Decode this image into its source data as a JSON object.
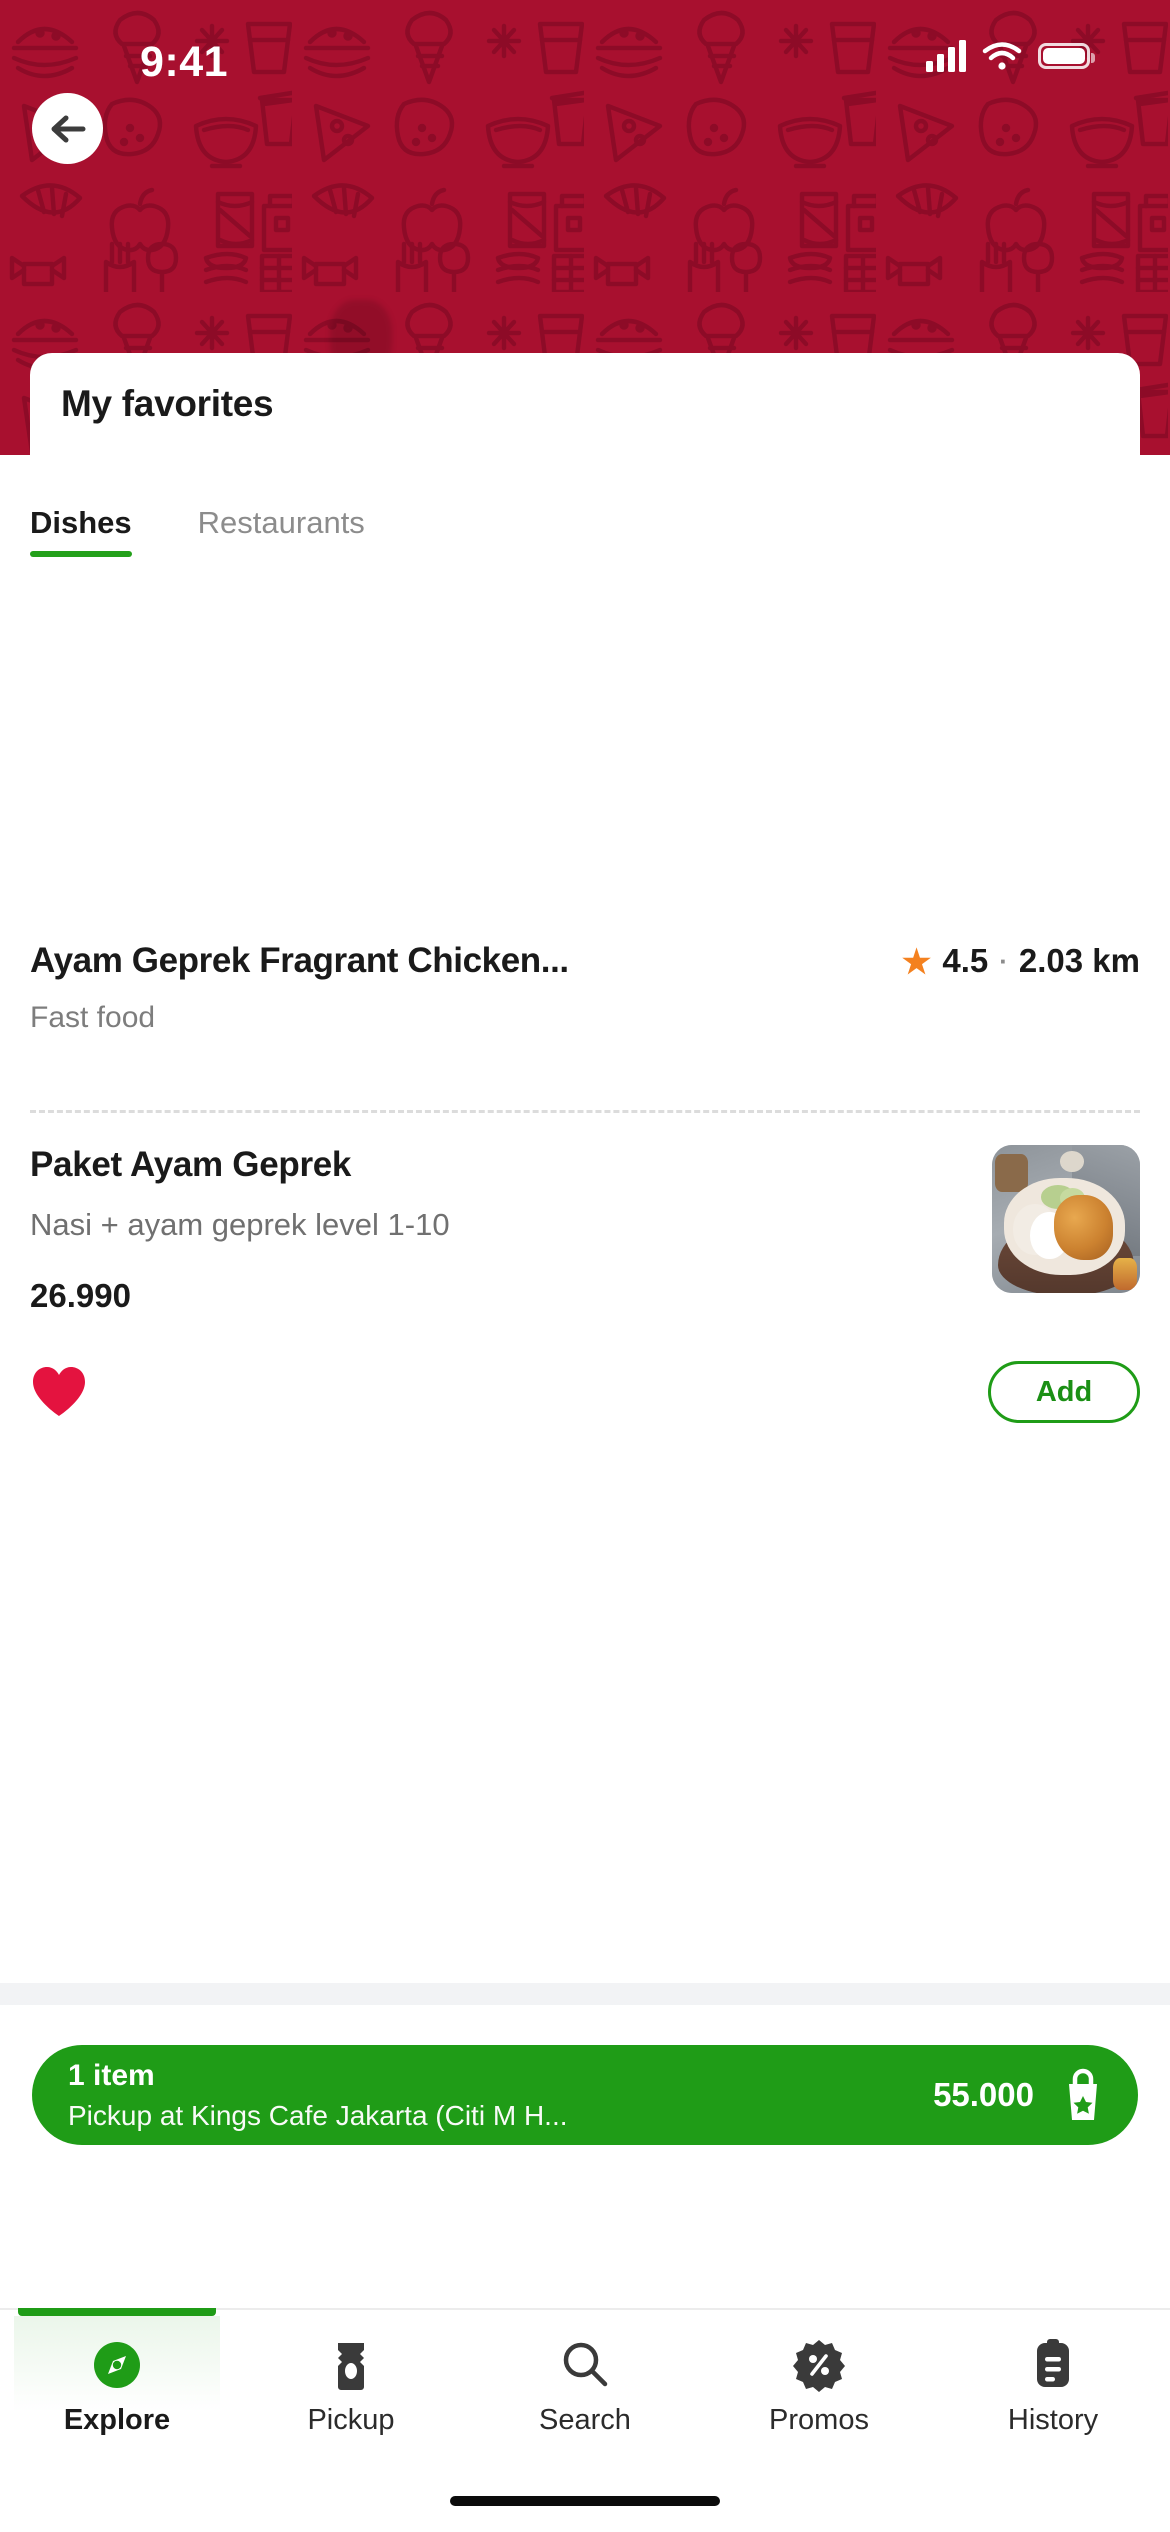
{
  "statusbar": {
    "time": "9:41",
    "signal_icon": "signal-bars-icon",
    "wifi_icon": "wifi-icon",
    "battery_icon": "battery-icon"
  },
  "header": {
    "back_icon": "back-arrow-icon",
    "background_color": "#a8102f",
    "title": "My favorites"
  },
  "tabs": [
    {
      "label": "Dishes",
      "active": true
    },
    {
      "label": "Restaurants",
      "active": false
    }
  ],
  "restaurant": {
    "name": "Ayam Geprek Fragrant Chicken...",
    "star_icon": "star-icon",
    "rating": "4.5",
    "separator": "·",
    "distance": "2.03 km",
    "category": "Fast food"
  },
  "dish": {
    "name": "Paket Ayam Geprek",
    "description": "Nasi + ayam geprek level 1-10",
    "price": "26.990",
    "thumbnail_alt": "paket-ayam-geprek-photo",
    "favorite_icon": "heart-filled-icon",
    "favorite_color": "#e4133f",
    "add_label": "Add",
    "add_color": "#1f9c17"
  },
  "cart": {
    "count_label": "1 item",
    "pickup_label": "Pickup at Kings Cafe Jakarta (Citi M H...",
    "total": "55.000",
    "bag_icon": "shopping-bag-icon",
    "color": "#1f9c17"
  },
  "bottom_nav": [
    {
      "label": "Explore",
      "icon": "compass-icon",
      "active": true
    },
    {
      "label": "Pickup",
      "icon": "bag-icon",
      "active": false
    },
    {
      "label": "Search",
      "icon": "magnifier-icon",
      "active": false
    },
    {
      "label": "Promos",
      "icon": "discount-badge-icon",
      "active": false
    },
    {
      "label": "History",
      "icon": "receipt-icon",
      "active": false
    }
  ]
}
